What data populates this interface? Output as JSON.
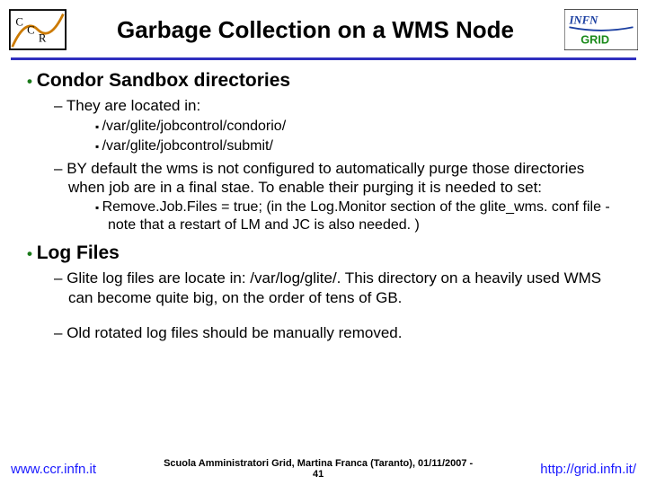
{
  "header": {
    "title": "Garbage Collection on a WMS Node",
    "logo_left_alt": "CCR logo",
    "logo_right_alt": "INFN Grid logo"
  },
  "content": {
    "sections": [
      {
        "heading": "Condor Sandbox directories",
        "items": [
          {
            "text": "They are located in:",
            "subitems": [
              "/var/glite/jobcontrol/condorio/",
              "/var/glite/jobcontrol/submit/"
            ]
          },
          {
            "text": "BY default the wms is not configured to automatically purge those directories when job are in a final stae. To enable their purging it is needed to set:",
            "subitems": [
              "Remove.Job.Files = true; (in the Log.Monitor section of the glite_wms. conf file - note that a restart of LM and JC is also needed. )"
            ]
          }
        ]
      },
      {
        "heading": "Log Files",
        "items": [
          {
            "text": "Glite log files are locate in: /var/log/glite/. This directory on a heavily used WMS can become quite big, on the order of tens of GB.",
            "subitems": []
          },
          {
            "text": "Old rotated log files should be manually removed.",
            "subitems": []
          }
        ]
      }
    ]
  },
  "footer": {
    "left": "www.ccr.infn.it",
    "center_line1": "Scuola Amministratori Grid, Martina Franca (Taranto), 01/11/2007 -",
    "center_line2": "41",
    "right": "http://grid.infn.it/"
  }
}
